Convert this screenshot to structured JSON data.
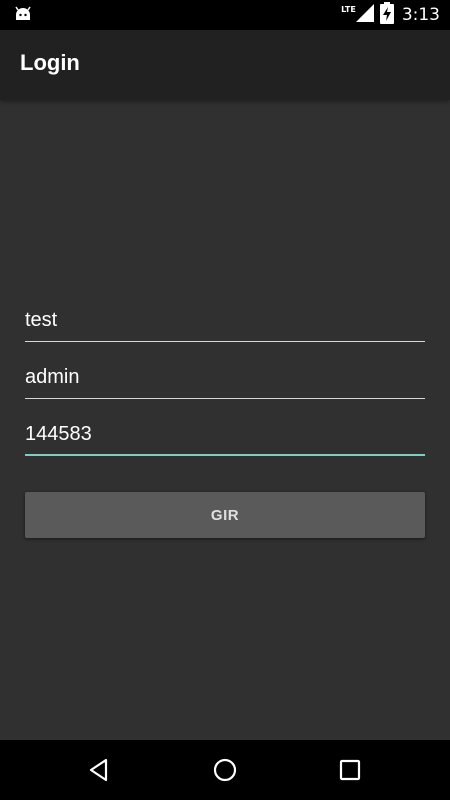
{
  "status_bar": {
    "network_label": "LTE",
    "time": "3:13",
    "icons": [
      "android-icon",
      "signal-icon",
      "battery-charging-icon"
    ]
  },
  "app_bar": {
    "title": "Login"
  },
  "form": {
    "field1_value": "test",
    "field2_value": "admin",
    "field3_value": "144583",
    "submit_label": "GIR"
  },
  "nav_bar": {
    "icons": [
      "back-icon",
      "home-icon",
      "recents-icon"
    ]
  },
  "colors": {
    "background": "#303030",
    "app_bar": "#212121",
    "accent": "#80cbc4",
    "button": "#5a5a5a"
  }
}
